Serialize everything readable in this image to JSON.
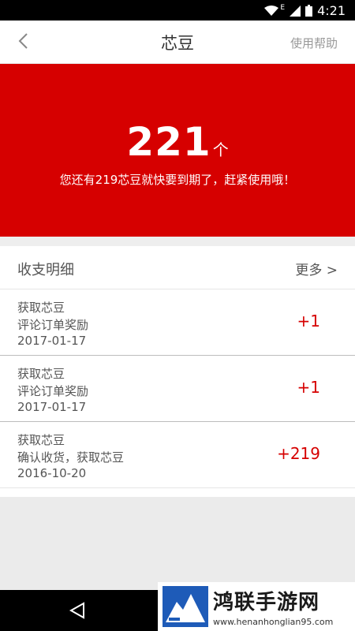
{
  "status_bar": {
    "time": "4:21",
    "network_label": "E"
  },
  "header": {
    "title": "芯豆",
    "help_label": "使用帮助"
  },
  "hero": {
    "count": "221",
    "unit": "个",
    "note": "您还有219芯豆就快要到期了，赶紧使用哦！"
  },
  "details": {
    "title": "收支明细",
    "more_label": "更多 >",
    "rows": [
      {
        "type": "获取芯豆",
        "desc": "评论订单奖励",
        "date": "2017-01-17",
        "amount": "+1"
      },
      {
        "type": "获取芯豆",
        "desc": "评论订单奖励",
        "date": "2017-01-17",
        "amount": "+1"
      },
      {
        "type": "获取芯豆",
        "desc": "确认收货，获取芯豆",
        "date": "2016-10-20",
        "amount": "+219"
      }
    ]
  },
  "watermark": {
    "title": "鸿联手游网",
    "url": "www.henanhonglian95.com"
  },
  "colors": {
    "accent": "#d60000",
    "header_bg": "#ffffff",
    "page_bg": "#ebebeb"
  }
}
